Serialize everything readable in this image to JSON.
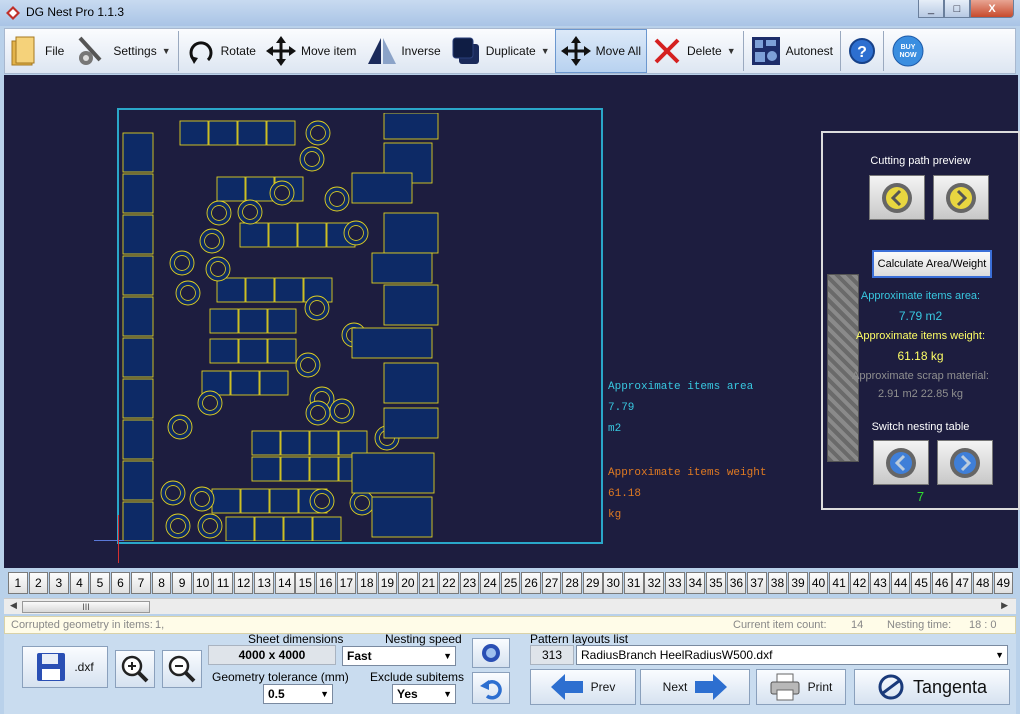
{
  "window": {
    "title": "DG Nest Pro 1.1.3",
    "min": "_",
    "max": "□",
    "close": "X"
  },
  "toolbar": {
    "file": "File",
    "settings": "Settings",
    "rotate": "Rotate",
    "move_item": "Move item",
    "inverse": "Inverse",
    "duplicate": "Duplicate",
    "move_all": "Move All",
    "delete": "Delete",
    "autonest": "Autonest",
    "help": "?",
    "buy_now": "BUY NOW"
  },
  "canvas": {
    "area_label": "Approximate items area",
    "area_value": "7.79",
    "area_unit": "m2",
    "weight_label": "Approximate items weight",
    "weight_value": "61.18",
    "weight_unit": "kg"
  },
  "side_panel": {
    "cutting_preview": "Cutting path preview",
    "calc_button": "Calculate Area/Weight",
    "area_label": "Approximate items area:",
    "area_value": "7.79  m2",
    "weight_label": "Approximate items weight:",
    "weight_value": "61.18  kg",
    "scrap_label": "Approximate scrap material:",
    "scrap_value": "2.91 m2   22.85 kg",
    "switch_label": "Switch nesting table",
    "table_index": "7",
    "colors": {
      "area": "#38c8e0",
      "weight": "#ffff66",
      "index": "#30e030"
    }
  },
  "tabs": [
    "1",
    "2",
    "3",
    "4",
    "5",
    "6",
    "7",
    "8",
    "9",
    "10",
    "11",
    "12",
    "13",
    "14",
    "15",
    "16",
    "17",
    "18",
    "19",
    "20",
    "21",
    "22",
    "23",
    "24",
    "25",
    "26",
    "27",
    "28",
    "29",
    "30",
    "31",
    "32",
    "33",
    "34",
    "35",
    "36",
    "37",
    "38",
    "39",
    "40",
    "41",
    "42",
    "43",
    "44",
    "45",
    "46",
    "47",
    "48",
    "49"
  ],
  "status": {
    "corrupted_label": "Corrupted geometry in items:",
    "corrupted_value": "1,",
    "item_count_label": "Current item count:",
    "item_count_value": "14",
    "nesting_time_label": "Nesting time:",
    "nesting_time_value": "18 : 0"
  },
  "bottom": {
    "save_dxf": ".dxf",
    "sheet_dimensions_label": "Sheet dimensions",
    "sheet_dimensions_value": "4000 x 4000",
    "geometry_tolerance_label": "Geometry tolerance (mm)",
    "geometry_tolerance_value": "0.5",
    "nesting_speed_label": "Nesting speed",
    "nesting_speed_value": "Fast",
    "exclude_subitems_label": "Exclude subitems",
    "exclude_subitems_value": "Yes",
    "pattern_list_label": "Pattern layouts list",
    "pattern_count": "313",
    "pattern_selected": "RadiusBranch HeelRadiusW500.dxf",
    "prev": "Prev",
    "next": "Next",
    "print": "Print",
    "brand": "Tangenta"
  }
}
